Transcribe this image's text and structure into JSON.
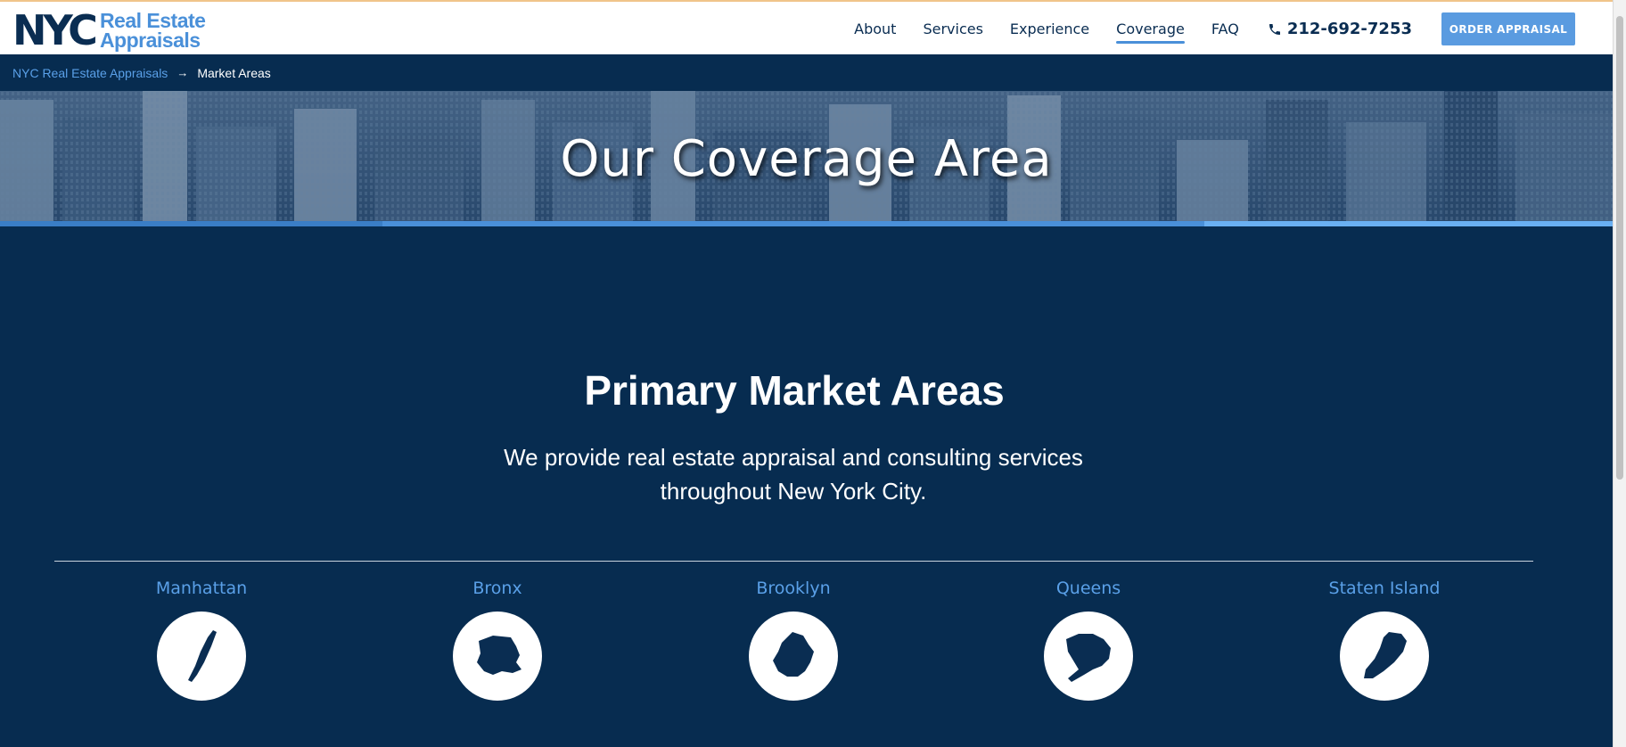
{
  "brand": {
    "logo_main": "NYC",
    "logo_line1": "Real Estate",
    "logo_line2": "Appraisals"
  },
  "nav": {
    "items": [
      {
        "label": "About",
        "active": false
      },
      {
        "label": "Services",
        "active": false
      },
      {
        "label": "Experience",
        "active": false
      },
      {
        "label": "Coverage",
        "active": true
      },
      {
        "label": "FAQ",
        "active": false
      }
    ],
    "phone": "212-692-7253",
    "order_label": "ORDER APPRAISAL"
  },
  "breadcrumb": {
    "home": "NYC Real Estate Appraisals",
    "separator": "→",
    "current": "Market Areas"
  },
  "hero": {
    "title": "Our Coverage Area"
  },
  "main": {
    "title": "Primary Market Areas",
    "description": "We provide real estate appraisal and consulting services throughout New York City."
  },
  "areas": [
    {
      "name": "Manhattan",
      "icon": "manhattan-map-icon"
    },
    {
      "name": "Bronx",
      "icon": "bronx-map-icon"
    },
    {
      "name": "Brooklyn",
      "icon": "brooklyn-map-icon"
    },
    {
      "name": "Queens",
      "icon": "queens-map-icon"
    },
    {
      "name": "Staten Island",
      "icon": "staten-island-map-icon"
    }
  ],
  "colors": {
    "navy": "#072c50",
    "accent": "#4a90d9",
    "button": "#5a9be0"
  }
}
